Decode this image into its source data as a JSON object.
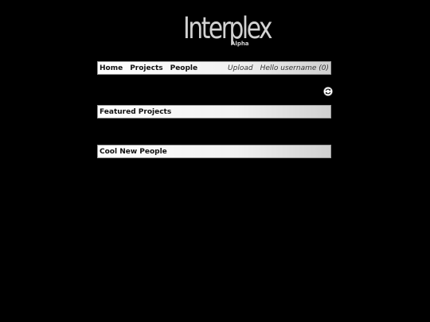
{
  "logo": {
    "name": "Interplex",
    "tag": "Alpha"
  },
  "nav": {
    "links": [
      "Home",
      "Projects",
      "People"
    ],
    "upload": "Upload",
    "greeting": "Hello username (0)"
  },
  "icons": {
    "refresh": "refresh-icon"
  },
  "sections": {
    "featured_title": "Featured Projects",
    "people_title": "Cool New People"
  }
}
